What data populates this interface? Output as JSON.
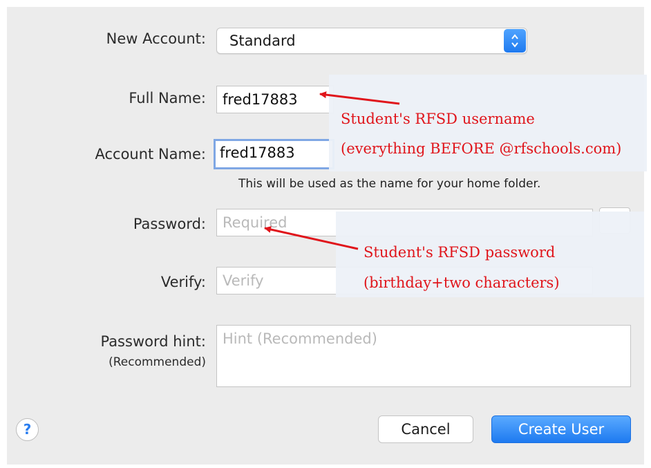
{
  "form": {
    "new_account_label": "New Account:",
    "new_account_value": "Standard",
    "full_name_label": "Full Name:",
    "full_name_value": "fred17883",
    "account_name_label": "Account Name:",
    "account_name_value": "fred17883",
    "home_folder_note": "This will be used as the name for your home folder.",
    "password_label": "Password:",
    "password_placeholder": "Required",
    "verify_label": "Verify:",
    "verify_placeholder": "Verify",
    "hint_label": "Password hint:",
    "hint_sublabel": "(Recommended)",
    "hint_placeholder": "Hint (Recommended)"
  },
  "annotations": {
    "username_line1": "Student's RFSD username",
    "username_line2": "(everything BEFORE @rfschools.com)",
    "password_line1": "Student's RFSD password",
    "password_line2": "(birthday+two characters)",
    "color": "#e0151b"
  },
  "buttons": {
    "help": "?",
    "cancel": "Cancel",
    "create": "Create User"
  },
  "icons": {
    "popup_arrows": "up-down-chevron-icon",
    "help": "question-mark-icon"
  }
}
